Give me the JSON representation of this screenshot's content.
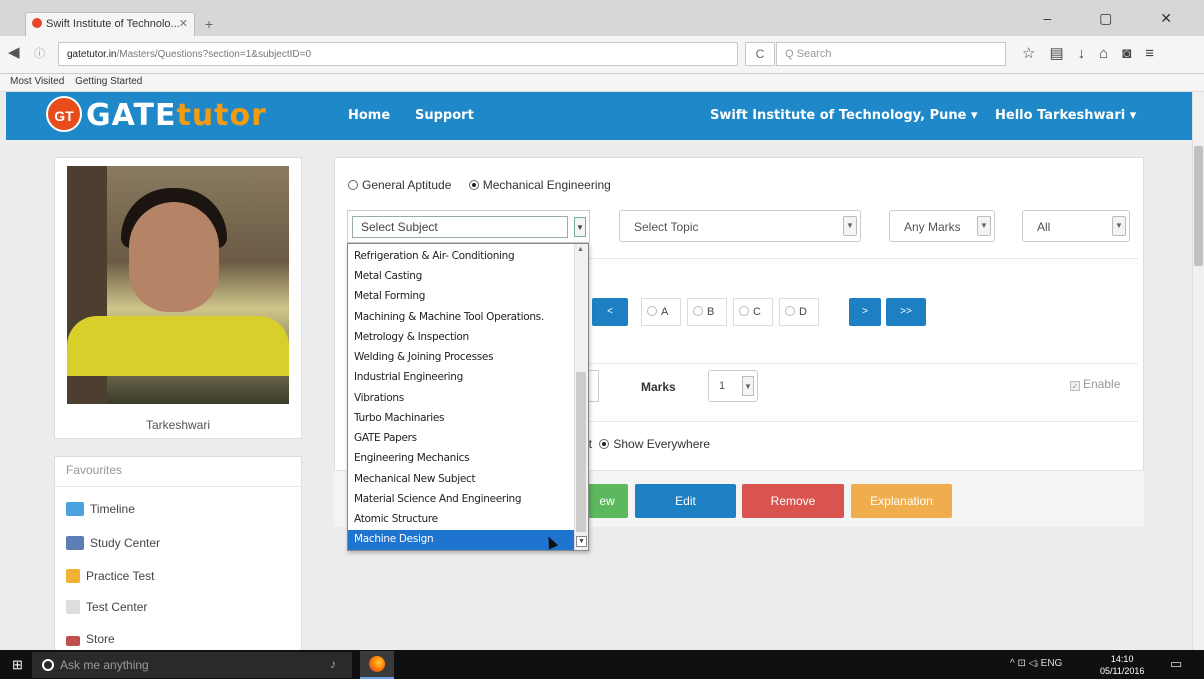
{
  "browser": {
    "tab_title": "Swift Institute of Technolo...",
    "tab_close": "✕",
    "new_tab": "+",
    "url_host": "gatetutor.in",
    "url_path": "/Masters/Questions?section=1&subjectID=0",
    "reload": "C",
    "search_placeholder": "Q Search",
    "bookmarks": [
      "Most Visited",
      "Getting Started"
    ],
    "window_controls": "– ▢ ✕"
  },
  "header": {
    "logo_badge": "GT",
    "logo_main": "GATE",
    "logo_accent": "tutor",
    "nav": [
      "Home",
      "Support"
    ],
    "institute": "Swift Institute of Technology, Pune ▾",
    "user": "Hello Tarkeshwari ▾",
    "brand_color": "#1e88c8"
  },
  "profile": {
    "name": "Tarkeshwari"
  },
  "favourites": {
    "title": "Favourites",
    "items": [
      "Timeline",
      "Study Center",
      "Practice Test",
      "Test Center",
      "Store"
    ]
  },
  "form": {
    "section_radios": [
      {
        "label": "General Aptitude",
        "checked": false
      },
      {
        "label": "Mechanical Engineering",
        "checked": true
      }
    ],
    "subject_select": "Select Subject",
    "topic_select": "Select Topic",
    "marks_filter": "Any Marks",
    "type_filter": "All",
    "nav_prev": "<",
    "nav_next": ">",
    "nav_last": ">>",
    "options": [
      "A",
      "B",
      "C",
      "D"
    ],
    "marks_label": "Marks",
    "marks_value": "1",
    "enable_label": "Enable",
    "show_options": [
      {
        "label": "est",
        "checked": false
      },
      {
        "label": "Show Everywhere",
        "checked": true
      }
    ],
    "actions": [
      {
        "label": "ew",
        "color": "#5cb85c"
      },
      {
        "label": "Edit",
        "color": "#1d80c3"
      },
      {
        "label": "Remove",
        "color": "#d9534f"
      },
      {
        "label": "Explanation",
        "color": "#f0ad4e"
      }
    ]
  },
  "subject_dropdown": {
    "items": [
      "Refrigeration & Air- Conditioning",
      "Metal Casting",
      "Metal Forming",
      "Machining & Machine Tool Operations.",
      "Metrology & Inspection",
      "Welding & Joining Processes",
      "Industrial Engineering",
      "Vibrations",
      "Turbo Machinaries",
      "GATE Papers",
      "Engineering Mechanics",
      "Mechanical New Subject",
      "Material Science And Engineering",
      "Atomic Structure",
      "Machine Design"
    ],
    "selected": "Machine Design"
  },
  "taskbar": {
    "search_placeholder": "Ask me anything",
    "tray": "^ ⊡ ◁ᵢ ENG",
    "time": "14:10",
    "date": "05/11/2016"
  }
}
